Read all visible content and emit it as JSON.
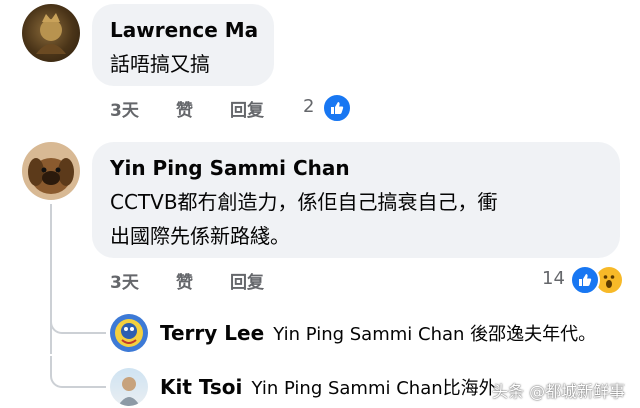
{
  "comment1": {
    "author": "Lawrence Ma",
    "text": "話唔搞又搞",
    "time": "3天",
    "like_label": "赞",
    "reply_label": "回复",
    "reaction_count": "2"
  },
  "comment2": {
    "author": "Yin Ping Sammi Chan",
    "text_line1": "CCTVB都冇創造力，係佢自己搞衰自己，衝",
    "text_line2": "出國際先係新路綫。",
    "time": "3天",
    "like_label": "赞",
    "reply_label": "回复",
    "reaction_count": "14"
  },
  "replies": [
    {
      "author": "Terry Lee",
      "text": "Yin Ping Sammi Chan 後邵逸夫年代。"
    },
    {
      "author": "Kit Tsoi",
      "text": "Yin Ping Sammi Chan比海外"
    }
  ],
  "watermark": "头条 @都城新鲜事",
  "colors": {
    "like_blue": "#1877f2",
    "wow_yellow": "#f7b928",
    "muted": "#65676b",
    "bubble": "#f0f2f5"
  }
}
